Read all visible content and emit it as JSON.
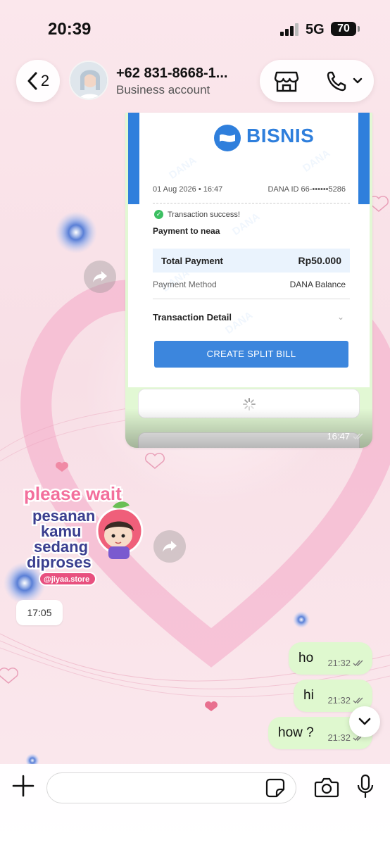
{
  "status_bar": {
    "time": "20:39",
    "network": "5G",
    "battery": "70"
  },
  "header": {
    "back_count": "2",
    "contact_name": "+62 831-8668-1...",
    "contact_subtitle": "Business account"
  },
  "receipt": {
    "brand": "BISNIS",
    "date": "01 Aug 2026 • 16:47",
    "dana_id": "DANA ID 66-••••••5286",
    "status": "Transaction success!",
    "payment_to": "Payment to neaa",
    "total_label": "Total Payment",
    "total_value": "Rp50.000",
    "method_label": "Payment Method",
    "method_value": "DANA Balance",
    "detail_label": "Transaction Detail",
    "split_button": "CREATE SPLIT BILL",
    "watermark": "DANA",
    "time": "16:47"
  },
  "sticker": {
    "line1": "please wait",
    "line2": "pesanan",
    "line3": "kamu",
    "line4": "sedang",
    "line5": "diproses",
    "handle": "@jiyaa.store"
  },
  "time_chip": "17:05",
  "outgoing_messages": [
    {
      "text": "ho",
      "time": "21:32"
    },
    {
      "text": "hi",
      "time": "21:32"
    },
    {
      "text": "how ?",
      "time": "21:32"
    }
  ],
  "composer": {
    "input_value": "",
    "placeholder": ""
  },
  "colors": {
    "bubble_out": "#dff8cf",
    "dana_blue": "#2f7fdc",
    "wallpaper": "#f9e6ea"
  }
}
